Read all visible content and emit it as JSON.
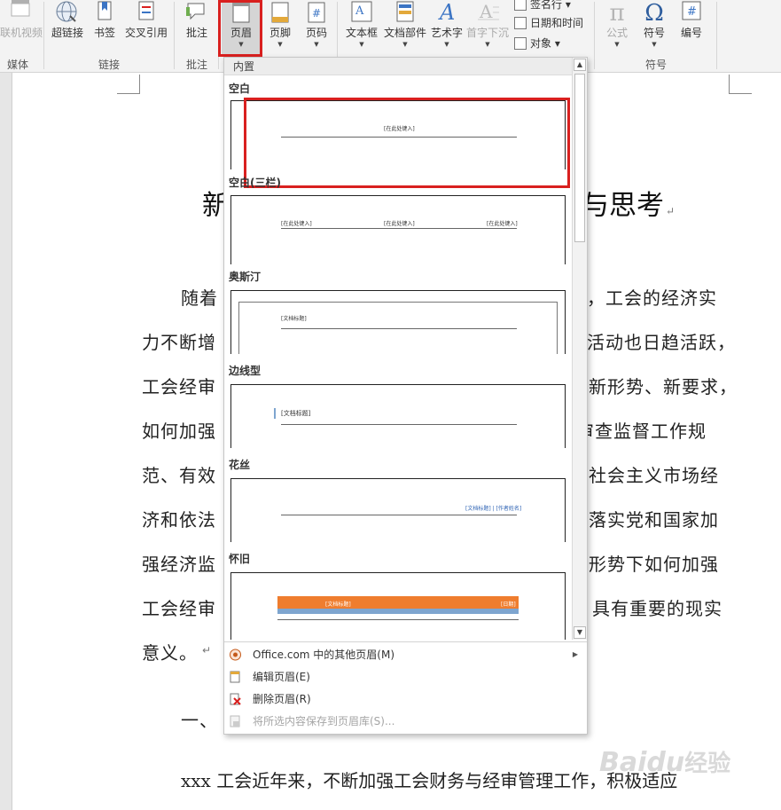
{
  "ribbon": {
    "buttons": {
      "media_video": "联机视频",
      "hyperlink": "超链接",
      "bookmark": "书签",
      "cross_ref": "交叉引用",
      "comment": "批注",
      "header": "页眉",
      "footer": "页脚",
      "page_number": "页码",
      "textbox": "文本框",
      "doc_parts": "文档部件",
      "wordart": "艺术字",
      "dropcap": "首字下沉",
      "signature": "签名行",
      "datetime": "日期和时间",
      "object": "对象",
      "equation": "公式",
      "symbol": "符号",
      "number": "编号"
    },
    "glyphs": {
      "pi": "π",
      "omega": "Ω",
      "hash": "#",
      "wordart_a": "A",
      "textbox_a": "A",
      "dropcap_a": "A"
    },
    "groups": {
      "media": "媒体",
      "links": "链接",
      "comments": "批注",
      "symbols": "符号"
    }
  },
  "gallery": {
    "header": "内置",
    "sections": [
      {
        "label": "空白",
        "placeholders": [
          "[在此处键入]"
        ]
      },
      {
        "label": "空白(三栏)",
        "placeholders": [
          "[在此处键入]",
          "[在此处键入]",
          "[在此处键入]"
        ]
      },
      {
        "label": "奥斯汀",
        "placeholders": [
          "[文档标题]"
        ]
      },
      {
        "label": "边线型",
        "placeholders": [
          "[文档标题]"
        ]
      },
      {
        "label": "花丝",
        "placeholders": [
          "[文档标题] | [作者姓名]"
        ]
      },
      {
        "label": "怀旧",
        "placeholders": [
          "[文档标题]",
          "[日期]"
        ]
      }
    ],
    "menu": [
      {
        "label": "Office.com 中的其他页眉(M)",
        "enabled": true,
        "submenu": true
      },
      {
        "label": "编辑页眉(E)",
        "enabled": true,
        "submenu": false
      },
      {
        "label": "删除页眉(R)",
        "enabled": true,
        "submenu": false
      },
      {
        "label": "将所选内容保存到页眉库(S)...",
        "enabled": false,
        "submenu": false
      }
    ]
  },
  "document": {
    "title_left": "新",
    "title_right": "与思考",
    "lines_left": [
      "随着",
      "力不断增",
      "工会经审",
      "如何加强",
      "范、有效",
      "济和依法",
      "强经济监",
      "工会经审",
      "意义。"
    ],
    "lines_right": [
      "，工会的经济实",
      "活动也日趋活跃，",
      "新形势、新要求，",
      "审查监督工作规",
      "社会主义市场经",
      "落实党和国家加",
      "形势下如何加强",
      "具有重要的现实"
    ],
    "heading_fragment": "一、",
    "last_line": "xxx 工会近年来，不断加强工会财务与经审管理工作，积极适应",
    "para_mark": "↵"
  },
  "watermark": {
    "brand": "Baidu",
    "sub": "经验"
  },
  "colors": {
    "accent_red": "#d9201f",
    "ribbon_bg": "#f3f3f3",
    "retro_orange": "#ef7d2e",
    "retro_blue": "#7ea5cf",
    "placeholder_blue": "#2e63b4"
  }
}
